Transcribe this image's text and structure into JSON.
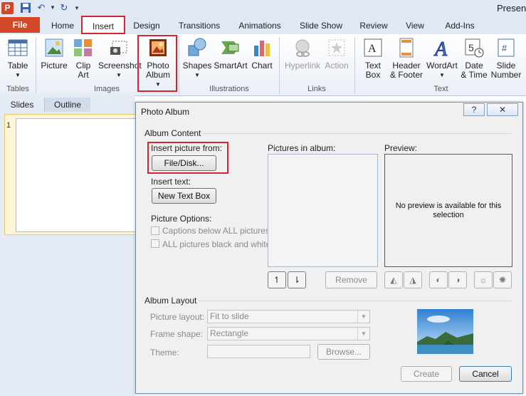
{
  "window": {
    "title_partial": "Present"
  },
  "ribbon_tabs": [
    "File",
    "Home",
    "Insert",
    "Design",
    "Transitions",
    "Animations",
    "Slide Show",
    "Review",
    "View",
    "Add-Ins"
  ],
  "ribbon": {
    "tables": {
      "table": "Table",
      "group": "Tables"
    },
    "images": {
      "picture": "Picture",
      "clip_art_1": "Clip",
      "clip_art_2": "Art",
      "screenshot": "Screenshot",
      "photo_album_1": "Photo",
      "photo_album_2": "Album",
      "group": "Images"
    },
    "illustrations": {
      "shapes": "Shapes",
      "smartart": "SmartArt",
      "chart": "Chart",
      "group": "Illustrations"
    },
    "links": {
      "hyperlink": "Hyperlink",
      "action": "Action",
      "group": "Links"
    },
    "text": {
      "text_box_1": "Text",
      "text_box_2": "Box",
      "header_footer_1": "Header",
      "header_footer_2": "& Footer",
      "wordart": "WordArt",
      "date_time_1": "Date",
      "date_time_2": "& Time",
      "slide_number_1": "Slide",
      "slide_number_2": "Number",
      "group": "Text"
    }
  },
  "left_pane": {
    "tabs": [
      "Slides",
      "Outline"
    ],
    "slide_number": "1"
  },
  "dialog": {
    "title": "Photo Album",
    "help": "?",
    "close": "✕",
    "album_content": {
      "legend": "Album Content",
      "insert_picture_from": "Insert picture from:",
      "file_disk_button": "File/Disk...",
      "insert_text": "Insert text:",
      "new_text_box_button": "New Text Box",
      "picture_options": "Picture Options:",
      "captions_option": "Captions below ALL pictures",
      "black_white_option": "ALL pictures black and white",
      "pictures_in_album": "Pictures in album:",
      "preview_label": "Preview:",
      "no_preview_line1": "No preview is available for this",
      "no_preview_line2": "selection",
      "move_up": "↿",
      "move_down": "⇂",
      "remove_button": "Remove"
    },
    "album_layout": {
      "legend": "Album Layout",
      "picture_layout_label": "Picture layout:",
      "picture_layout_value": "Fit to slide",
      "frame_shape_label": "Frame shape:",
      "frame_shape_value": "Rectangle",
      "theme_label": "Theme:",
      "theme_value": "",
      "browse_button": "Browse..."
    },
    "create_button": "Create",
    "cancel_button": "Cancel"
  },
  "colors": {
    "file_tab": "#d24726",
    "highlight": "#d22630",
    "title_bar": "#dfe8f3"
  }
}
